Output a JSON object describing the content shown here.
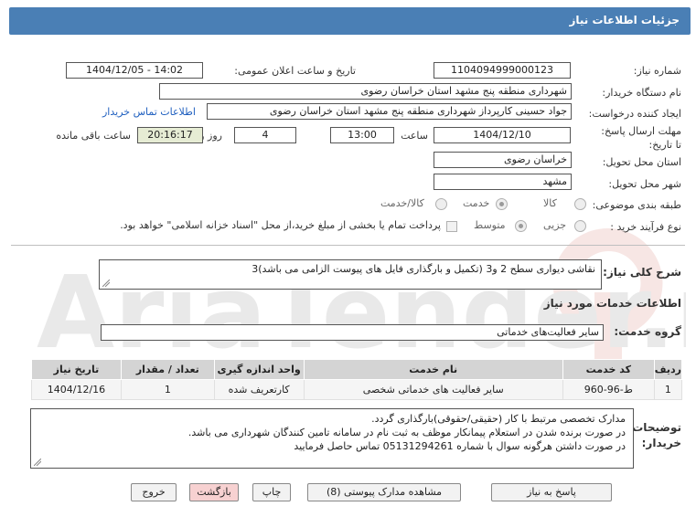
{
  "header": {
    "title": "جزئیات اطلاعات نیاز"
  },
  "need_number": {
    "label": "شماره نیاز:",
    "value": "1104094999000123"
  },
  "announce_datetime": {
    "label": "تاریخ و ساعت اعلان عمومی:",
    "value": "1404/12/05 - 14:02"
  },
  "buyer_org": {
    "label": "نام دستگاه خریدار:",
    "value": "شهرداری منطقه پنج مشهد استان خراسان رضوی"
  },
  "requester": {
    "label": "ایجاد کننده درخواست:",
    "value": "جواد حسینی کارپرداز شهرداری منطقه پنج مشهد استان خراسان رضوی",
    "contact_link": "اطلاعات تماس خریدار"
  },
  "deadline": {
    "label": "مهلت ارسال پاسخ: تا تاریخ:",
    "date": "1404/12/10",
    "time_label": "ساعت",
    "time": "13:00",
    "days": "4",
    "days_label": "روز و",
    "remaining": "20:16:17",
    "remaining_label": "ساعت باقی مانده"
  },
  "delivery_province": {
    "label": "استان محل تحویل:",
    "value": "خراسان رضوی"
  },
  "delivery_city": {
    "label": "شهر محل تحویل:",
    "value": "مشهد"
  },
  "category": {
    "label": "طبقه بندی موضوعی:",
    "options": [
      "کالا",
      "خدمت",
      "کالا/خدمت"
    ],
    "selected": "خدمت"
  },
  "purchase_type": {
    "label": "نوع فرآیند خرید :",
    "options": [
      "جزیی",
      "متوسط"
    ],
    "selected": "متوسط",
    "payment_note": "پرداخت تمام یا بخشی از مبلغ خرید،از محل \"اسناد خزانه اسلامی\" خواهد بود."
  },
  "description": {
    "label": "شرح کلی نیاز:",
    "value": "نقاشی دیواری سطح 2 و3 (تکمیل و بارگذاری فایل های پیوست الزامی می باشد)3"
  },
  "services_heading": "اطلاعات خدمات مورد نیاز",
  "service_group": {
    "label": "گروه خدمت:",
    "value": "سایر فعالیت‌های خدماتی"
  },
  "table": {
    "headers": [
      "ردیف",
      "کد خدمت",
      "نام خدمت",
      "واحد اندازه گیری",
      "تعداد / مقدار",
      "تاریخ نیاز"
    ],
    "rows": [
      [
        "1",
        "ط-96-960",
        "سایر فعالیت های خدماتی شخصی",
        "کارتعریف شده",
        "1",
        "1404/12/16"
      ]
    ]
  },
  "buyer_notes": {
    "label": "توضیحات خریدار:",
    "lines": [
      "مدارک تخصصی مرتبط با کار (حقیقی/حقوقی)بارگذاری گردد.",
      "در صورت برنده شدن در استعلام پیمانکار موظف به ثبت نام در سامانه تامین کنندگان شهرداری می باشد.",
      "در صورت داشتن هرگونه سوال  با شماره 05131294261 تماس حاصل فرمایید"
    ]
  },
  "buttons": {
    "reply": "پاسخ به نیاز",
    "docs": "مشاهده مدارک پیوستی (8)",
    "print": "چاپ",
    "back": "بازگشت",
    "exit": "خروج"
  },
  "watermark": "AriaTender.net",
  "colors": {
    "header": "#4a7fb5",
    "time_left_bg": "#e6ecd4",
    "back_button": "#f7d1d1",
    "link": "#1f5fbf"
  }
}
